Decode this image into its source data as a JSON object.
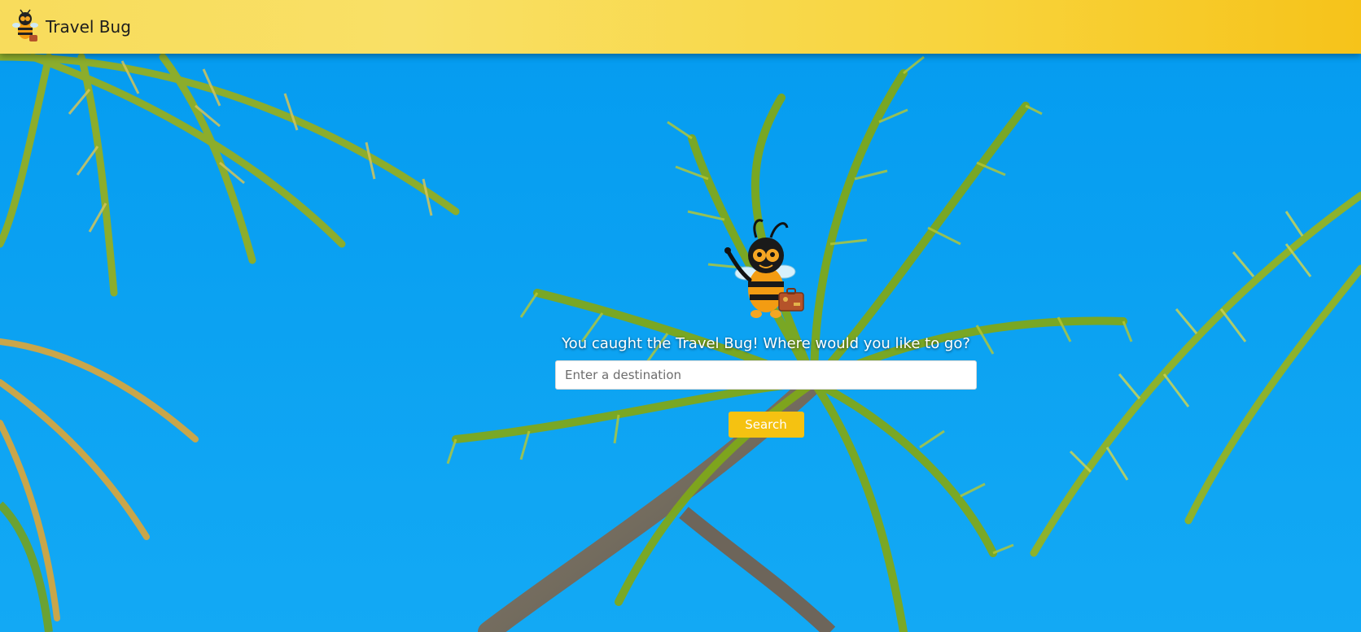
{
  "header": {
    "brand_title": "Travel Bug",
    "logo_icon": "bee-mascot-icon"
  },
  "hero": {
    "mascot_icon": "bee-with-suitcase-icon",
    "tagline": "You caught the Travel Bug! Where would you like to go?",
    "search": {
      "placeholder": "Enter a destination",
      "value": ""
    },
    "search_button_label": "Search"
  },
  "theme": {
    "header_gradient_start": "#f8dc5c",
    "header_gradient_end": "#f6c31a",
    "sky": "#0ba4f5",
    "button": "#f5c211"
  }
}
